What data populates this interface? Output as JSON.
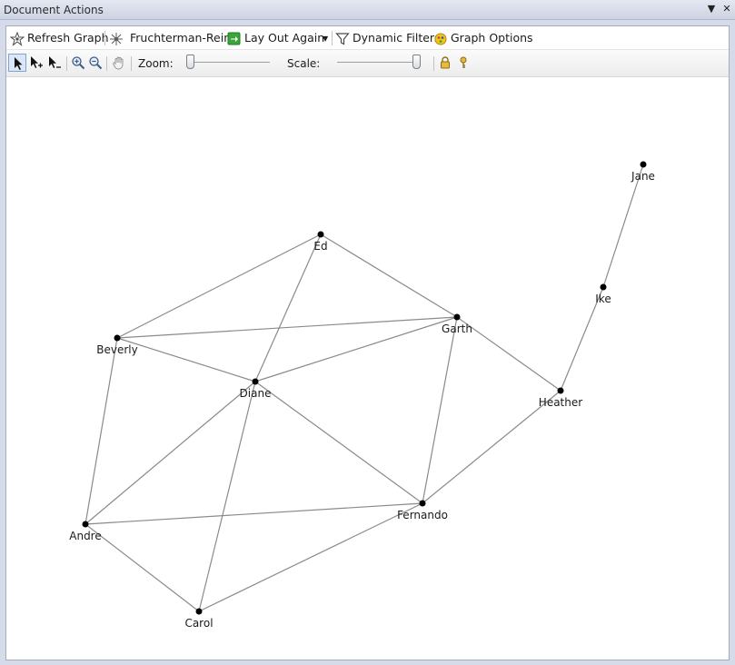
{
  "window": {
    "title": "Document Actions",
    "pin_glyph": "▼",
    "close_glyph": "✕"
  },
  "toolbar": {
    "refresh_label": "Refresh Graph",
    "layout_label": "Fruchterman-Rein",
    "layout_again_label": "Lay Out Again",
    "filters_label": "Dynamic Filters",
    "options_label": "Graph Options",
    "zoom_label": "Zoom:",
    "scale_label": "Scale:",
    "zoom_level": 0.0,
    "scale_level": 1.0,
    "icons": [
      "refresh-graph-icon",
      "layout-algorithm-icon",
      "lay-out-again-icon",
      "dynamic-filters-icon",
      "graph-options-icon",
      "select-pointer-icon",
      "add-to-selection-icon",
      "remove-from-selection-icon",
      "zoom-in-icon",
      "zoom-out-icon",
      "pan-hand-icon",
      "lock-icon",
      "key-icon"
    ]
  },
  "graph": {
    "nodes": [
      {
        "id": "Jane",
        "label": "Jane"
      },
      {
        "id": "Ike",
        "label": "Ike"
      },
      {
        "id": "Ed",
        "label": "Ed"
      },
      {
        "id": "Garth",
        "label": "Garth"
      },
      {
        "id": "Beverly",
        "label": "Beverly"
      },
      {
        "id": "Diane",
        "label": "Diane"
      },
      {
        "id": "Heather",
        "label": "Heather"
      },
      {
        "id": "Fernando",
        "label": "Fernando"
      },
      {
        "id": "Andre",
        "label": "Andre"
      },
      {
        "id": "Carol",
        "label": "Carol"
      }
    ],
    "edges": [
      [
        "Jane",
        "Ike"
      ],
      [
        "Ike",
        "Heather"
      ],
      [
        "Ed",
        "Beverly"
      ],
      [
        "Ed",
        "Diane"
      ],
      [
        "Ed",
        "Garth"
      ],
      [
        "Beverly",
        "Garth"
      ],
      [
        "Beverly",
        "Diane"
      ],
      [
        "Beverly",
        "Andre"
      ],
      [
        "Diane",
        "Garth"
      ],
      [
        "Garth",
        "Heather"
      ],
      [
        "Garth",
        "Fernando"
      ],
      [
        "Diane",
        "Fernando"
      ],
      [
        "Diane",
        "Andre"
      ],
      [
        "Diane",
        "Carol"
      ],
      [
        "Heather",
        "Fernando"
      ],
      [
        "Andre",
        "Fernando"
      ],
      [
        "Andre",
        "Carol"
      ],
      [
        "Carol",
        "Fernando"
      ]
    ],
    "colors": {
      "edge": "#8a8a8a",
      "node": "#000000",
      "label": "#1a1a1a"
    }
  }
}
